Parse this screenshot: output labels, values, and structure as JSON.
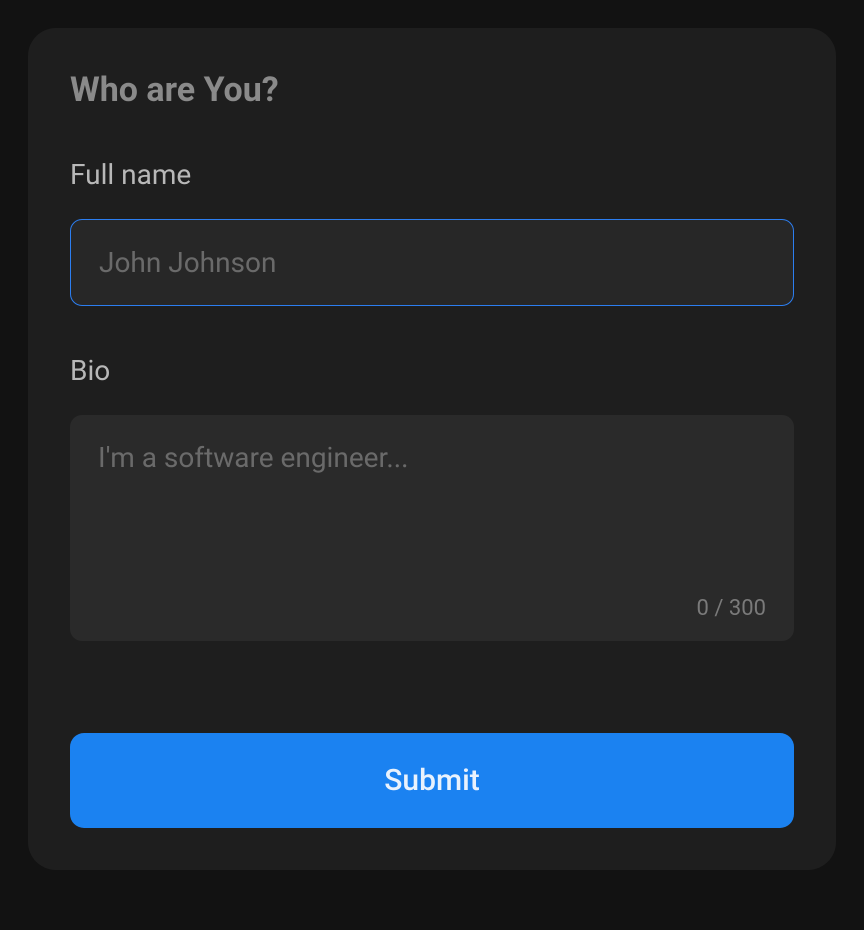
{
  "form": {
    "heading": "Who are You?",
    "full_name": {
      "label": "Full name",
      "placeholder": "John Johnson",
      "value": ""
    },
    "bio": {
      "label": "Bio",
      "placeholder": "I'm a software engineer...",
      "value": "",
      "counter": "0 / 300"
    },
    "submit_label": "Submit"
  }
}
